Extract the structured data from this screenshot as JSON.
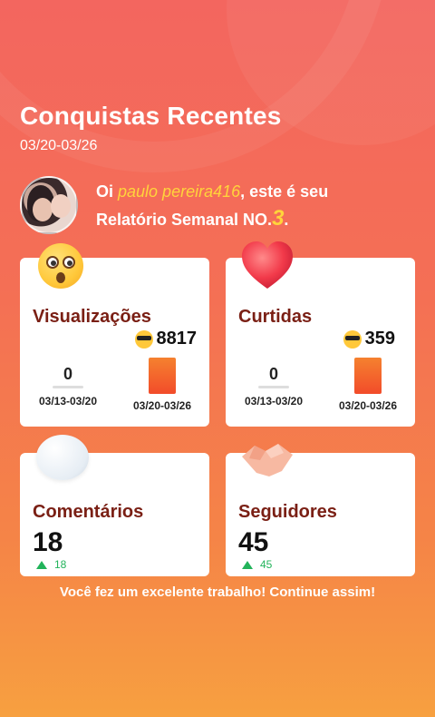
{
  "header": {
    "title": "Conquistas Recentes",
    "date_range": "03/20-03/26"
  },
  "greeting": {
    "prefix": "Oi ",
    "username": "paulo pereira416",
    "middle": ", este é seu",
    "line2": "Relatório Semanal NO.",
    "report_number": "3",
    "suffix": "."
  },
  "cards": {
    "views": {
      "title": "Visualizações",
      "total": "8817",
      "prev_value": "0",
      "prev_range": "03/13-03/20",
      "curr_range": "03/20-03/26"
    },
    "likes": {
      "title": "Curtidas",
      "total": "359",
      "prev_value": "0",
      "prev_range": "03/13-03/20",
      "curr_range": "03/20-03/26"
    },
    "comments": {
      "title": "Comentários",
      "total": "18",
      "delta": "18"
    },
    "followers": {
      "title": "Seguidores",
      "total": "45",
      "delta": "45"
    }
  },
  "footer": {
    "message": "Você fez um excelente trabalho! Continue assim!"
  },
  "colors": {
    "accent_yellow": "#ffd43b",
    "card_title": "#7a1f14",
    "positive": "#22b35a",
    "bar_top": "#f5812f",
    "bar_bottom": "#f24c2a"
  }
}
